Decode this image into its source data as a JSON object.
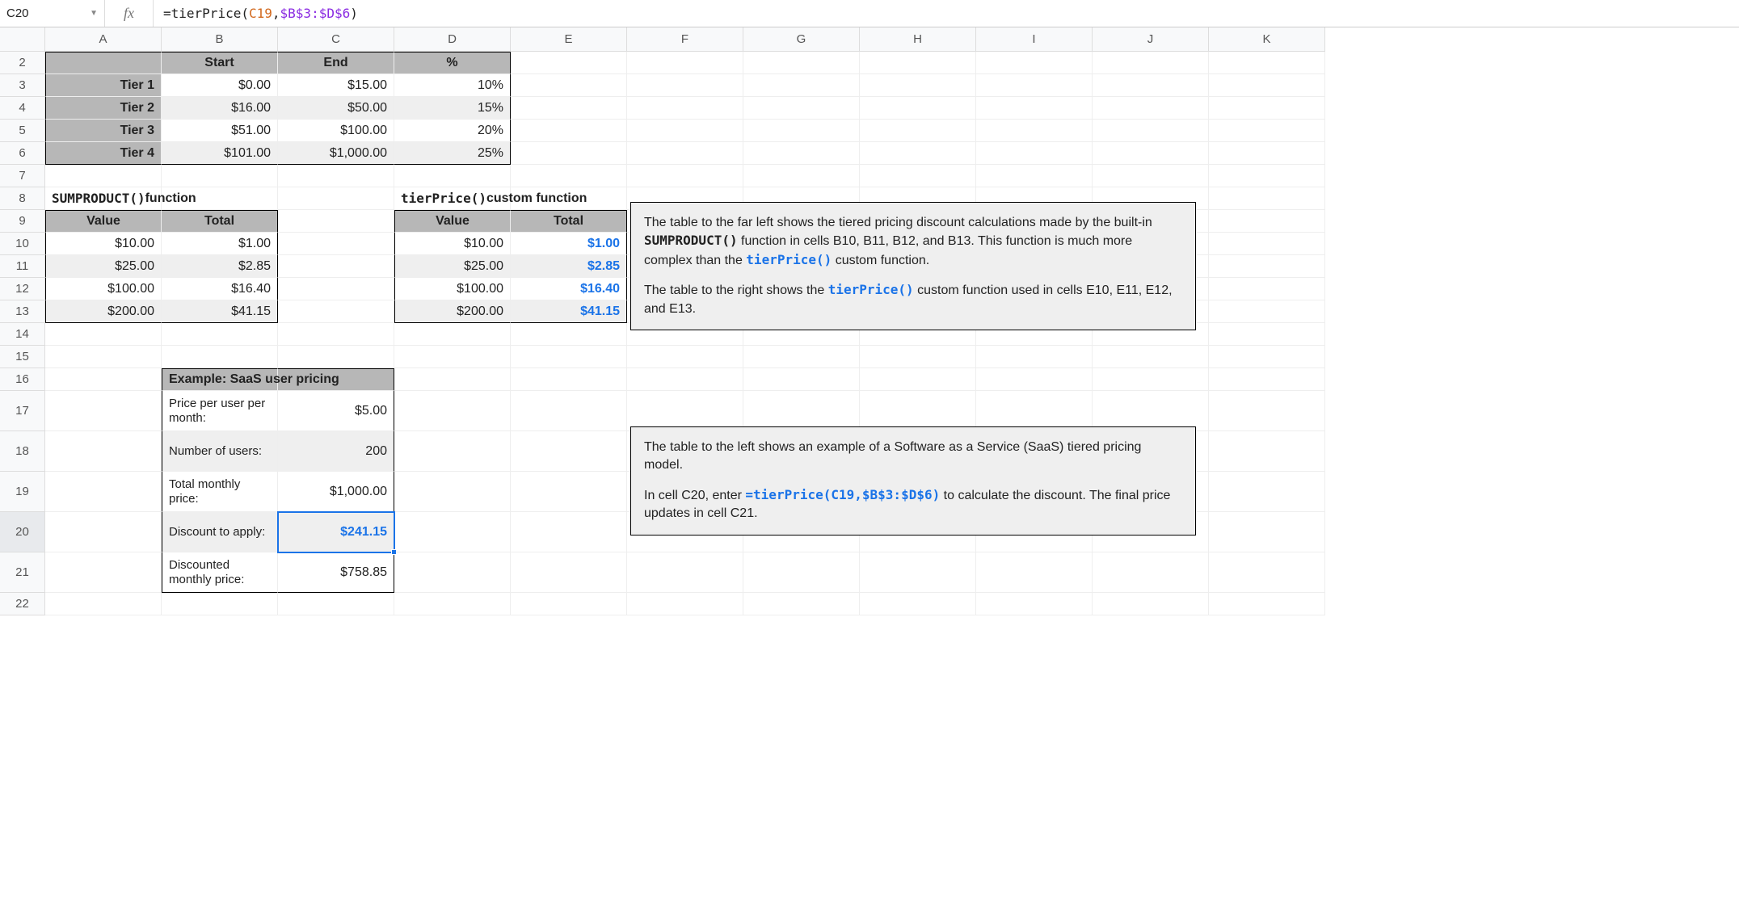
{
  "formula_bar": {
    "cell_ref": "C20",
    "fx_label": "fx",
    "prefix": "=",
    "fn": "tierPrice",
    "open": "(",
    "arg1": "C19",
    "comma": ",",
    "arg2": "$B$3:$D$6",
    "close": ")"
  },
  "columns": [
    "A",
    "B",
    "C",
    "D",
    "E",
    "F",
    "G",
    "H",
    "I",
    "J",
    "K"
  ],
  "rows": [
    "2",
    "3",
    "4",
    "5",
    "6",
    "7",
    "8",
    "9",
    "10",
    "11",
    "12",
    "13",
    "14",
    "15",
    "16",
    "17",
    "18",
    "19",
    "20",
    "21",
    "22"
  ],
  "tier_table": {
    "headers": {
      "start": "Start",
      "end": "End",
      "pct": "%"
    },
    "rows": [
      {
        "name": "Tier 1",
        "start": "$0.00",
        "end": "$15.00",
        "pct": "10%"
      },
      {
        "name": "Tier 2",
        "start": "$16.00",
        "end": "$50.00",
        "pct": "15%"
      },
      {
        "name": "Tier 3",
        "start": "$51.00",
        "end": "$100.00",
        "pct": "20%"
      },
      {
        "name": "Tier 4",
        "start": "$101.00",
        "end": "$1,000.00",
        "pct": "25%"
      }
    ]
  },
  "sumproduct": {
    "title_fn": "SUMPRODUCT()",
    "title_suffix": " function",
    "headers": {
      "value": "Value",
      "total": "Total"
    },
    "rows": [
      {
        "value": "$10.00",
        "total": "$1.00"
      },
      {
        "value": "$25.00",
        "total": "$2.85"
      },
      {
        "value": "$100.00",
        "total": "$16.40"
      },
      {
        "value": "$200.00",
        "total": "$41.15"
      }
    ]
  },
  "tierprice": {
    "title_fn": "tierPrice()",
    "title_suffix": " custom function",
    "headers": {
      "value": "Value",
      "total": "Total"
    },
    "rows": [
      {
        "value": "$10.00",
        "total": "$1.00"
      },
      {
        "value": "$25.00",
        "total": "$2.85"
      },
      {
        "value": "$100.00",
        "total": "$16.40"
      },
      {
        "value": "$200.00",
        "total": "$41.15"
      }
    ]
  },
  "saas": {
    "title": "Example: SaaS user pricing",
    "rows": [
      {
        "label": "Price per user per month:",
        "value": "$5.00"
      },
      {
        "label": "Number of users:",
        "value": "200"
      },
      {
        "label": "Total monthly price:",
        "value": "$1,000.00"
      },
      {
        "label": "Discount to apply:",
        "value": "$241.15"
      },
      {
        "label": "Discounted monthly price:",
        "value": "$758.85"
      }
    ]
  },
  "explain1": {
    "p1a": "The table to the far left shows the tiered pricing discount calculations made by the built-in ",
    "p1fn": "SUMPRODUCT()",
    "p1b": " function in cells B10, B11, B12, and B13. This function is much more complex than the ",
    "p1fn2": "tierPrice()",
    "p1c": " custom function.",
    "p2a": "The table to the right shows the ",
    "p2fn": "tierPrice()",
    "p2b": " custom function used in cells E10, E11, E12, and E13."
  },
  "explain2": {
    "p1": "The table to the left shows an example of a Software as a Service (SaaS) tiered pricing model.",
    "p2a": "In cell C20, enter ",
    "formula": "=tierPrice(C19,$B$3:$D$6)",
    "p2b": " to calculate the discount. The final price updates in cell C21."
  }
}
